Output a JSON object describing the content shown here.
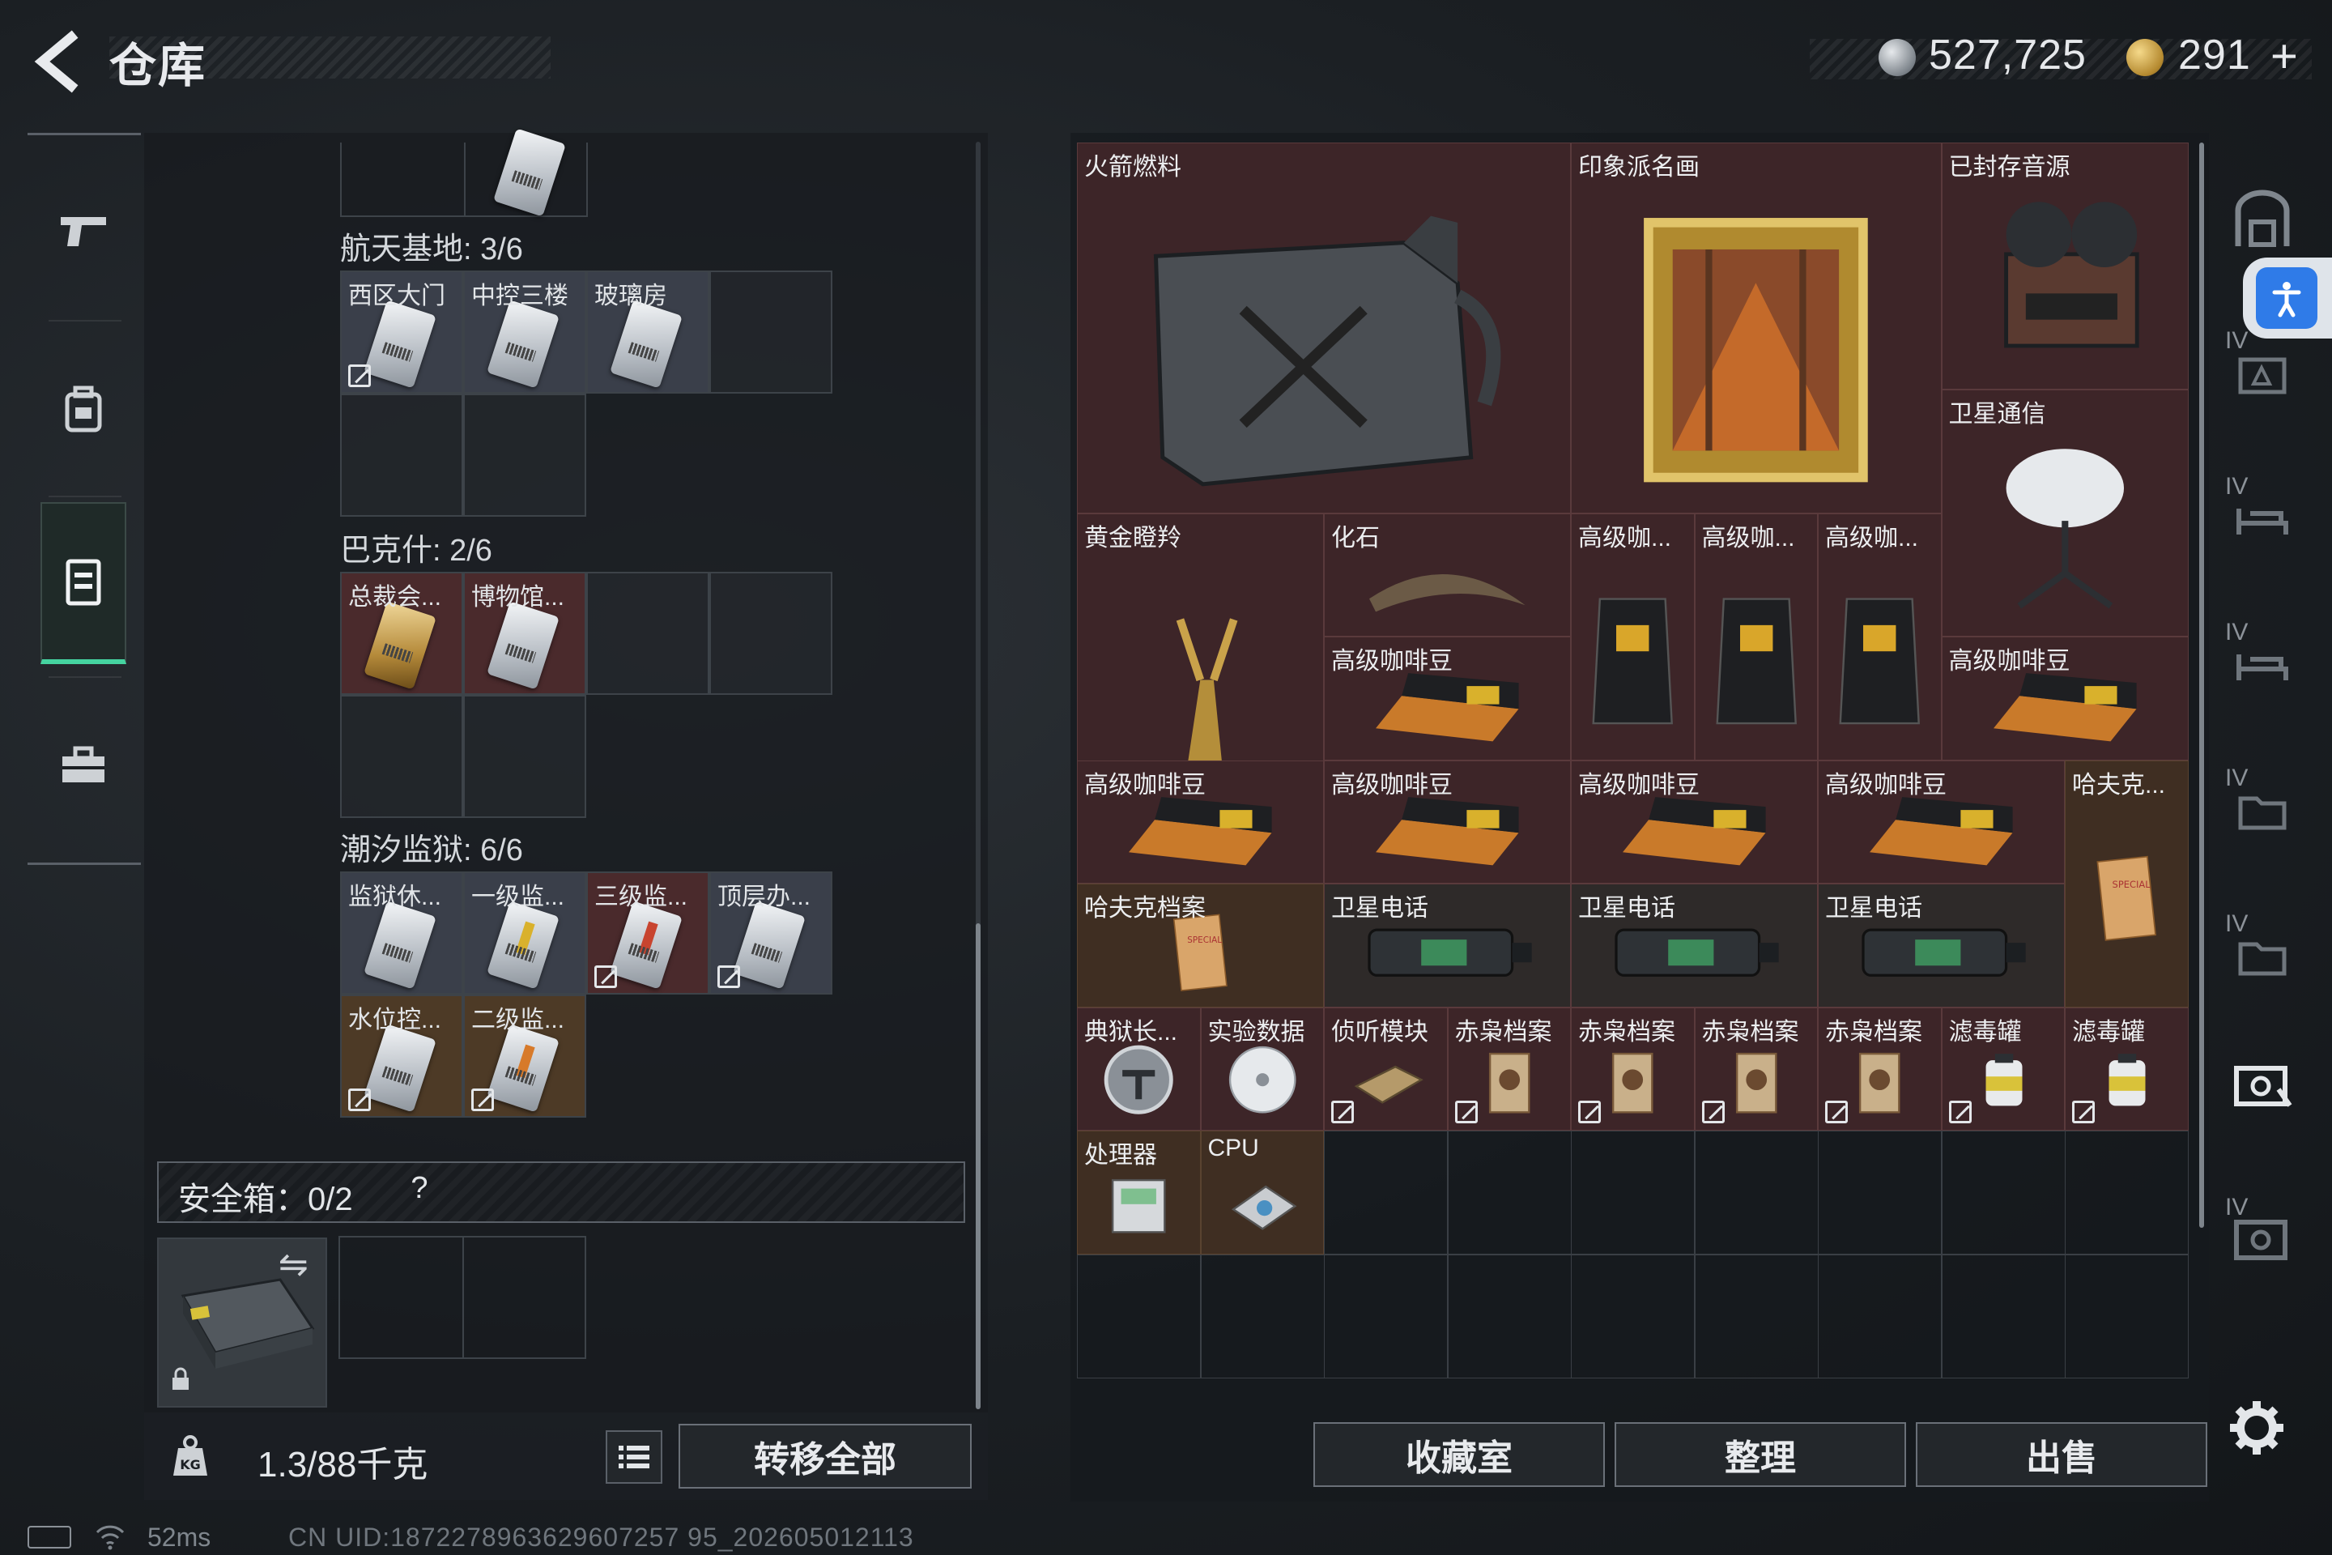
{
  "header": {
    "title": "仓库",
    "currency_silver": "527,725",
    "currency_gold": "291",
    "plus_label": "+"
  },
  "left_nav": [
    "weapons",
    "armor",
    "storage",
    "tools"
  ],
  "collections": [
    {
      "label": "航天基地: 3/6",
      "slots": [
        {
          "label": "西区大门",
          "style": "filled",
          "card": "silver",
          "locked": true
        },
        {
          "label": "中控三楼",
          "style": "filled",
          "card": "silver",
          "locked": false
        },
        {
          "label": "玻璃房",
          "style": "filled",
          "card": "silver",
          "locked": false
        }
      ]
    },
    {
      "label": "巴克什: 2/6",
      "slots": [
        {
          "label": "总裁会...",
          "style": "red",
          "card": "gold",
          "locked": false
        },
        {
          "label": "博物馆...",
          "style": "red",
          "card": "silver",
          "locked": false
        }
      ]
    },
    {
      "label": "潮汐监狱: 6/6",
      "slots": [
        {
          "label": "监狱休...",
          "style": "filled",
          "card": "silver",
          "locked": false
        },
        {
          "label": "一级监...",
          "style": "filled",
          "card": "yellow",
          "locked": false
        },
        {
          "label": "三级监...",
          "style": "red",
          "card": "red",
          "locked": true
        },
        {
          "label": "顶层办...",
          "style": "filled",
          "card": "silver",
          "locked": true
        },
        {
          "label": "水位控...",
          "style": "gold",
          "card": "silver",
          "locked": true
        },
        {
          "label": "二级监...",
          "style": "gold",
          "card": "orange",
          "locked": true
        }
      ]
    }
  ],
  "safe_box": {
    "label": "安全箱：0/2",
    "help": "?"
  },
  "bottom_left": {
    "weight": "1.3/88千克",
    "transfer_all": "转移全部"
  },
  "items": [
    {
      "name": "火箭燃料",
      "kind": "jerrycan"
    },
    {
      "name": "印象派名画",
      "kind": "painting"
    },
    {
      "name": "已封存音源",
      "kind": "recorder"
    },
    {
      "name": "卫星通信",
      "kind": "dish"
    },
    {
      "name": "黄金瞪羚",
      "kind": "gazelle"
    },
    {
      "name": "化石",
      "kind": "fossil"
    },
    {
      "name": "高级咖...",
      "kind": "coffee-bag"
    },
    {
      "name": "高级咖...",
      "kind": "coffee-bag"
    },
    {
      "name": "高级咖...",
      "kind": "coffee-bag"
    },
    {
      "name": "高级咖啡豆",
      "kind": "coffee-box"
    },
    {
      "name": "高级咖啡豆",
      "kind": "coffee-box"
    },
    {
      "name": "高级咖啡豆",
      "kind": "coffee-box"
    },
    {
      "name": "高级咖啡豆",
      "kind": "coffee-box"
    },
    {
      "name": "高级咖啡豆",
      "kind": "coffee-box"
    },
    {
      "name": "高级咖啡豆",
      "kind": "coffee-box"
    },
    {
      "name": "哈夫克...",
      "kind": "folder"
    },
    {
      "name": "哈夫克档案",
      "kind": "folder"
    },
    {
      "name": "卫星电话",
      "kind": "phone"
    },
    {
      "name": "卫星电话",
      "kind": "phone"
    },
    {
      "name": "卫星电话",
      "kind": "phone"
    },
    {
      "name": "典狱长...",
      "kind": "emblem"
    },
    {
      "name": "实验数据",
      "kind": "disc"
    },
    {
      "name": "侦听模块",
      "kind": "module"
    },
    {
      "name": "赤枭档案",
      "kind": "dossier"
    },
    {
      "name": "赤枭档案",
      "kind": "dossier"
    },
    {
      "name": "赤枭档案",
      "kind": "dossier"
    },
    {
      "name": "赤枭档案",
      "kind": "dossier"
    },
    {
      "name": "滤毒罐",
      "kind": "canister"
    },
    {
      "name": "滤毒罐",
      "kind": "canister"
    },
    {
      "name": "处理器",
      "kind": "processor"
    },
    {
      "name": "CPU",
      "kind": "cpu"
    }
  ],
  "bottom_right": {
    "collection_room": "收藏室",
    "sort": "整理",
    "sell": "出售"
  },
  "right_nav_tags": [
    "IV",
    "IV",
    "IV",
    "IV",
    "IV",
    "IV"
  ],
  "status": {
    "ping": "52ms",
    "uid": "CN UID:1872278963629607257 95_202605012113"
  },
  "colors": {
    "accent": "#45d3a0",
    "item_bg": "#3d2528",
    "accessibility": "#2f7be8"
  }
}
